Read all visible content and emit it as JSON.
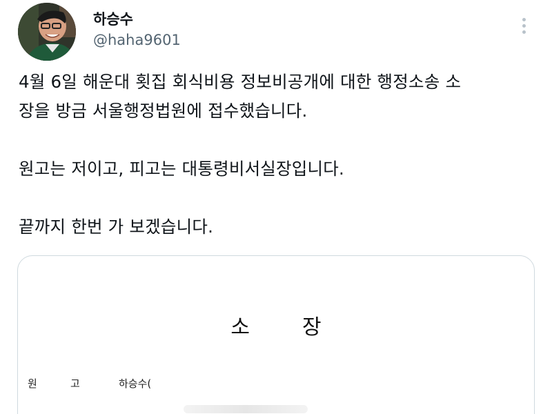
{
  "user": {
    "name": "하승수",
    "handle": "@haha9601"
  },
  "tweet": {
    "lines": [
      "4월 6일 해운대 횟집 회식비용 정보비공개에 대한 행정소송 소",
      "장을 방금 서울행정법원에 접수했습니다.",
      "",
      "원고는 저이고, 피고는 대통령비서실장입니다.",
      "",
      "끝까지 한번 가 보겠습니다."
    ]
  },
  "document": {
    "title_chars": [
      "소",
      "장"
    ],
    "plaintiff_label_1": "원",
    "plaintiff_label_2": "고",
    "plaintiff_name": "하승수("
  },
  "icons": {
    "more": "more-vertical-icon",
    "avatar": "profile-photo"
  },
  "colors": {
    "text": "#0f1419",
    "secondary": "#536471",
    "border": "#cfd9de"
  }
}
